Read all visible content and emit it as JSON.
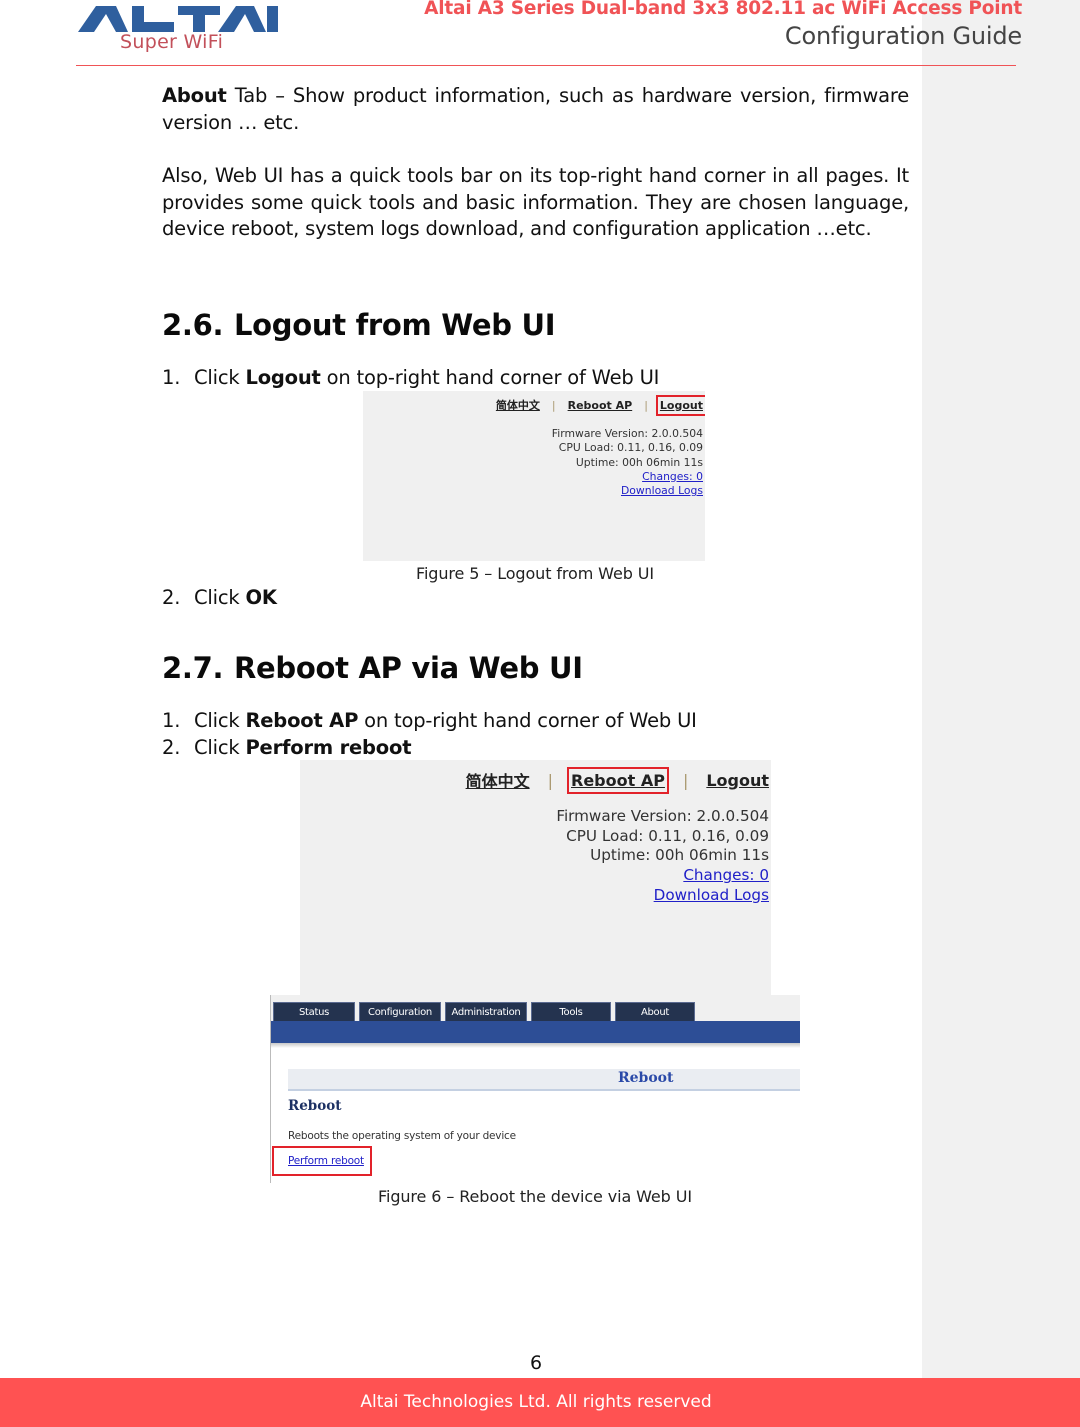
{
  "header": {
    "logo_text": "ALTAI",
    "logo_tagline": "Super WiFi",
    "title": "Altai A3 Series Dual-band 3x3 802.11 ac WiFi Access Point",
    "subtitle": "Configuration Guide",
    "colors": {
      "accent": "#f05356",
      "logo_blue": "#2f5f9e",
      "logo_red": "#c2505a"
    }
  },
  "intro": {
    "about_bold": "About",
    "about_rest": " Tab – Show product information, such as hardware version, firmware version … etc.",
    "quicktools": "Also, Web UI has a quick tools bar on its top-right hand corner in all pages. It provides some quick tools and basic information. They are chosen language, device reboot, system logs download, and configuration application …etc."
  },
  "section_26": {
    "number": "2.6.",
    "title": "Logout from Web UI",
    "steps": [
      {
        "n": "1.",
        "pre": "Click ",
        "bold": "Logout",
        "post": " on top-right hand corner of Web UI"
      },
      {
        "n": "2.",
        "pre": "Click ",
        "bold": "OK",
        "post": ""
      }
    ],
    "figure_caption": "Figure 5 – Logout from Web UI"
  },
  "section_27": {
    "number": "2.7.",
    "title": "Reboot AP via Web UI",
    "steps": [
      {
        "n": "1.",
        "pre": "Click ",
        "bold": "Reboot AP",
        "post": " on top-right hand corner of Web UI"
      },
      {
        "n": "2.",
        "pre": "Click ",
        "bold": "Perform reboot",
        "post": ""
      }
    ],
    "figure_caption": "Figure 6 – Reboot the device via Web UI"
  },
  "webui": {
    "quickbar": {
      "language": "简体中文",
      "separator": "|",
      "reboot": "Reboot AP",
      "logout": "Logout"
    },
    "info": {
      "firmware": "Firmware Version: 2.0.0.504",
      "cpu": "CPU Load: 0.11, 0.16, 0.09",
      "uptime": "Uptime: 00h 06min 11s",
      "changes": "Changes: 0",
      "download_logs": "Download Logs"
    },
    "tabs": [
      "Status",
      "Configuration",
      "Administration",
      "Tools",
      "About"
    ],
    "page_title": "Reboot",
    "section_title": "Reboot",
    "description": "Reboots the operating system of your device",
    "perform_link": "Perform reboot",
    "highlight_color": "#e2222a"
  },
  "footer": {
    "page_number": "6",
    "copyright": "Altai Technologies Ltd. All rights reserved"
  }
}
